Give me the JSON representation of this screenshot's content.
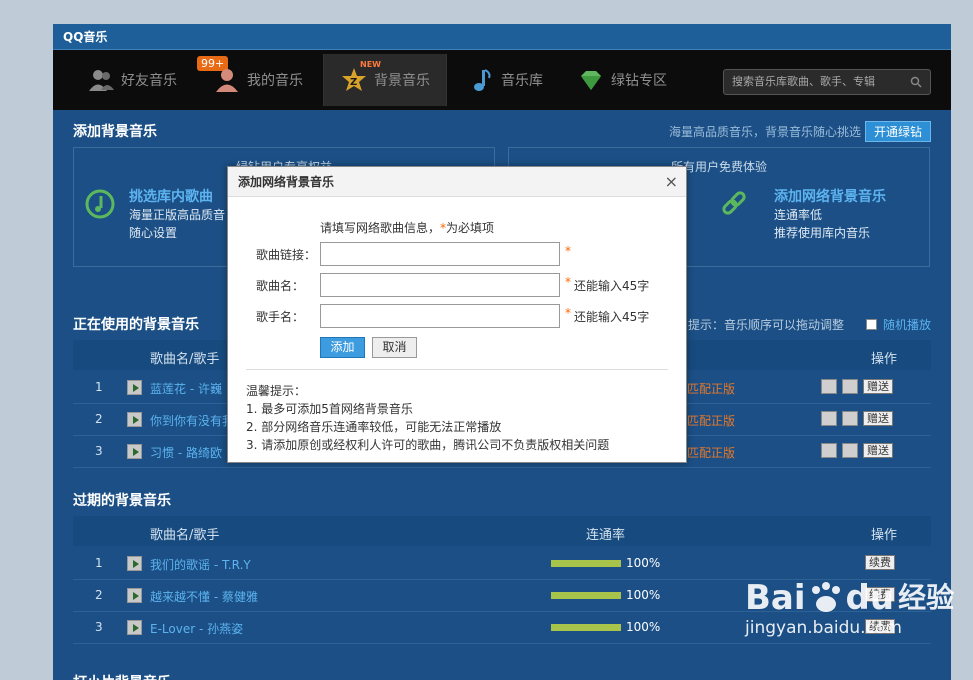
{
  "app": {
    "title": "QQ音乐"
  },
  "nav": {
    "items": [
      {
        "label": "好友音乐",
        "badge": "99+"
      },
      {
        "label": "我的音乐"
      },
      {
        "label": "背景音乐",
        "tag": "NEW"
      },
      {
        "label": "音乐库"
      },
      {
        "label": "绿钻专区"
      }
    ],
    "search_placeholder": "搜索音乐库歌曲、歌手、专辑"
  },
  "add_section": {
    "title": "添加背景音乐",
    "promo_text": "海量高品质音乐，背景音乐随心挑选",
    "promo_button": "开通绿钻",
    "card_left": {
      "head": "绿钻用户专享权益",
      "title": "挑选库内歌曲",
      "line1": "海量正版高品质音",
      "line2": "随心设置"
    },
    "card_right": {
      "head": "所有用户免费体验",
      "title": "添加网络背景音乐",
      "line1": "连通率低",
      "line2": "推荐使用库内音乐"
    }
  },
  "current": {
    "title": "正在使用的背景音乐",
    "hint": "提示：音乐顺序可以拖动调整",
    "random_label": "随机播放",
    "col_song": "歌曲名/歌手",
    "col_ops": "操作",
    "rows": [
      {
        "num": "1",
        "song": "蓝莲花 - 许巍",
        "match": "匹配正版",
        "gift": "赠送"
      },
      {
        "num": "2",
        "song": "你到你有没有我",
        "match": "匹配正版",
        "gift": "赠送"
      },
      {
        "num": "3",
        "song": "习惯 - 路绮欧",
        "match": "匹配正版",
        "gift": "赠送"
      }
    ]
  },
  "expired": {
    "title": "过期的背景音乐",
    "col_song": "歌曲名/歌手",
    "col_rate": "连通率",
    "col_ops": "操作",
    "rows": [
      {
        "num": "1",
        "song": "我们的歌谣 - T.R.Y",
        "rate": "100%",
        "renew": "续费"
      },
      {
        "num": "2",
        "song": "越来越不懂 - 蔡健雅",
        "rate": "100%",
        "renew": "续费"
      },
      {
        "num": "3",
        "song": "E-Lover - 孙燕姿",
        "rate": "100%",
        "renew": "续费"
      }
    ]
  },
  "bottom_title": "打小片背景音乐",
  "dialog": {
    "title": "添加网络背景音乐",
    "close": "×",
    "intro": "请填写网络歌曲信息，",
    "intro_req": "*",
    "intro_suffix": "为必填项",
    "field_link": "歌曲链接：",
    "field_name": "歌曲名：",
    "field_singer": "歌手名：",
    "req_mark": "*",
    "limit_name": "还能输入45字",
    "limit_singer": "还能输入45字",
    "add_button": "添加",
    "cancel_button": "取消",
    "tips_title": "温馨提示：",
    "tip1": "1. 最多可添加5首网络背景音乐",
    "tip2": "2. 部分网络音乐连通率较低，可能无法正常播放",
    "tip3": "3. 请添加原创或经权利人许可的歌曲，腾讯公司不负责版权相关问题"
  },
  "watermark": {
    "brand": "Bai",
    "brand2": "du",
    "cn": "经验",
    "url": "jingyan.baidu.com"
  }
}
